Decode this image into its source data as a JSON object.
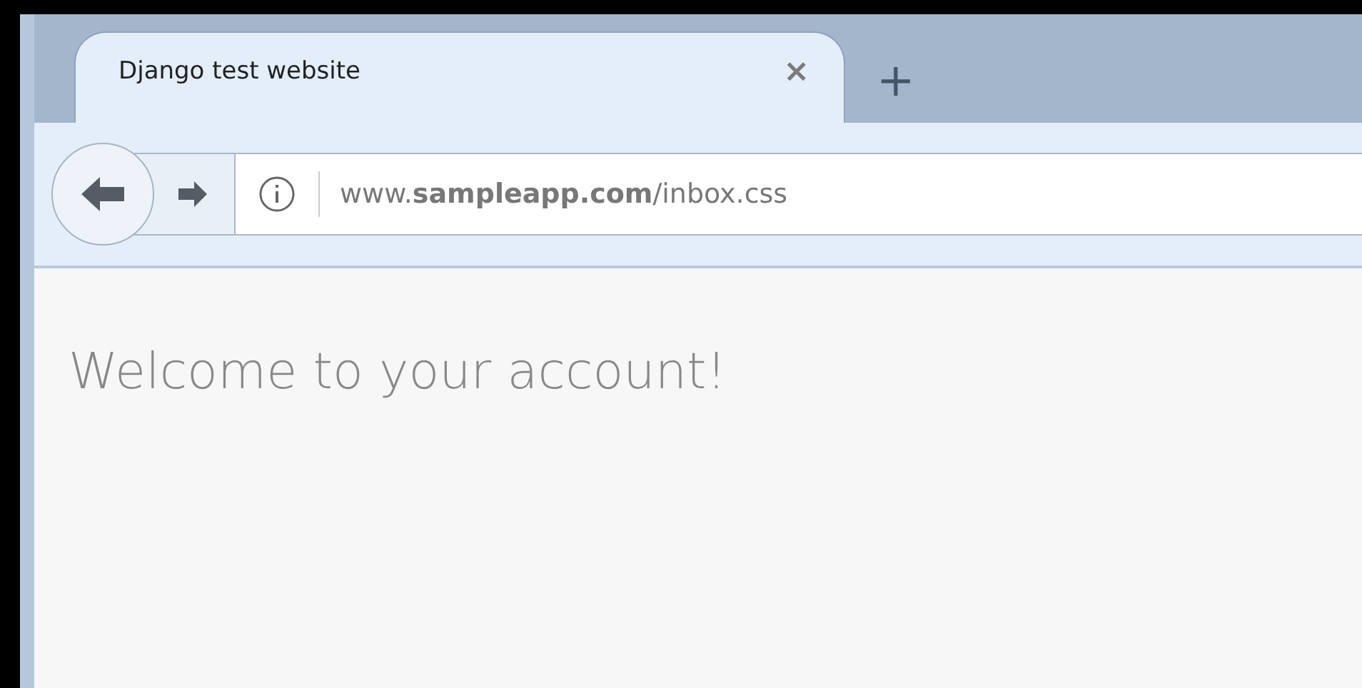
{
  "tabs": [
    {
      "title": "Django test website",
      "selected": true,
      "close": "×"
    }
  ],
  "new_tab": "+",
  "address_bar": {
    "url": "www.**sampleapp.com**/inbox.css"
  },
  "page": {
    "heading": "Welcome to your account!"
  }
}
